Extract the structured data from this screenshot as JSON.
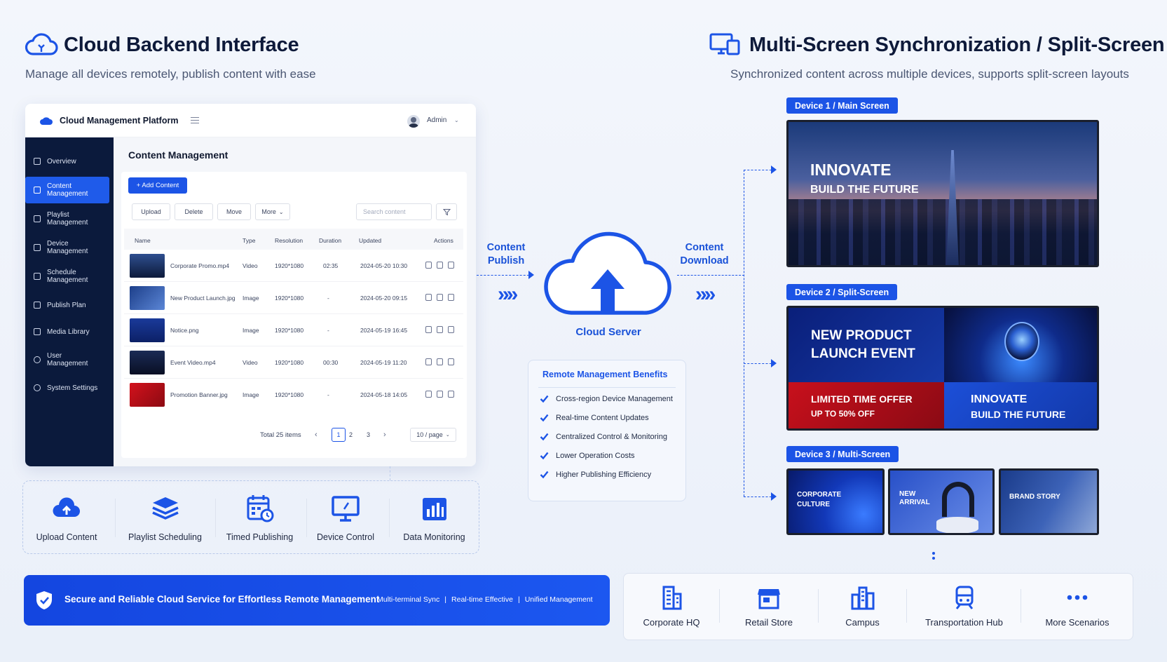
{
  "colors": {
    "accent": "#1c54e6",
    "sidebar_bg": "#0b1a3c",
    "heading": "#0e1a3a",
    "red_offer": "#c8101c"
  },
  "left_header": {
    "title": "Cloud Backend Interface",
    "subtitle": "Manage all devices remotely, publish content with ease",
    "icon": "cloud-icon"
  },
  "right_header": {
    "title": "Multi-Screen Synchronization / Split-Screen",
    "subtitle": "Synchronized content across multiple devices, supports split-screen layouts",
    "icon": "monitor-devices-icon"
  },
  "dashboard": {
    "app_title": "Cloud Management Platform",
    "user": "Admin",
    "sidebar": [
      {
        "label": "Overview",
        "icon": "home-icon"
      },
      {
        "label": "Content\nManagement",
        "icon": "edit-icon"
      },
      {
        "label": "Playlist\nManagement",
        "icon": "grid-icon"
      },
      {
        "label": "Device\nManagement",
        "icon": "grid-icon"
      },
      {
        "label": "Schedule\nManagement",
        "icon": "grid-icon"
      },
      {
        "label": "Publish Plan",
        "icon": "edit-icon"
      },
      {
        "label": "Media Library",
        "icon": "image-icon"
      },
      {
        "label": "User\nManagement",
        "icon": "user-icon"
      },
      {
        "label": "System Settings",
        "icon": "gear-icon"
      }
    ],
    "section_title": "Content Management",
    "add_button": "+ Add Content",
    "toolbar": {
      "upload": "Upload",
      "delete": "Delete",
      "move": "Move",
      "more": "More"
    },
    "search_placeholder": "Search content",
    "columns": [
      "Name",
      "Type",
      "Resolution",
      "Duration",
      "Updated",
      "Actions"
    ],
    "rows": [
      {
        "name": "Corporate Promo.mp4",
        "type": "Video",
        "resolution": "1920*1080",
        "duration": "02:35",
        "updated": "2024-05-20 10:30"
      },
      {
        "name": "New Product Launch.jpg",
        "type": "Image",
        "resolution": "1920*1080",
        "duration": "-",
        "updated": "2024-05-20 09:15"
      },
      {
        "name": "Notice.png",
        "type": "Image",
        "resolution": "1920*1080",
        "duration": "-",
        "updated": "2024-05-19 16:45"
      },
      {
        "name": "Event Video.mp4",
        "type": "Video",
        "resolution": "1920*1080",
        "duration": "00:30",
        "updated": "2024-05-19 11:20"
      },
      {
        "name": "Promotion Banner.jpg",
        "type": "Image",
        "resolution": "1920*1080",
        "duration": "-",
        "updated": "2024-05-18 14:05"
      }
    ],
    "pagination": {
      "total": "Total 25 items",
      "pages": [
        "1",
        "2",
        "3"
      ],
      "current": "1",
      "per_page": "10 / page"
    }
  },
  "features": [
    {
      "label": "Upload Content",
      "icon": "cloud-upload-icon"
    },
    {
      "label": "Playlist Scheduling",
      "icon": "layers-icon"
    },
    {
      "label": "Timed Publishing",
      "icon": "calendar-clock-icon"
    },
    {
      "label": "Device Control",
      "icon": "monitor-icon"
    },
    {
      "label": "Data Monitoring",
      "icon": "bar-chart-icon"
    }
  ],
  "banner": {
    "text": "Secure and Reliable Cloud Service for Effortless Remote Management",
    "tags": [
      "Multi-terminal Sync",
      "Real-time Effective",
      "Unified Management"
    ],
    "separator": "|",
    "icon": "shield-check-icon"
  },
  "flow": {
    "publish": "Content\nPublish",
    "download": "Content\nDownload",
    "server": "Cloud Server",
    "chevrons": "»»"
  },
  "benefits": {
    "title": "Remote Management Benefits",
    "items": [
      "Cross-region Device Management",
      "Real-time Content Updates",
      "Centralized Control & Monitoring",
      "Lower Operation Costs",
      "Higher Publishing Efficiency"
    ]
  },
  "devices": {
    "device1": {
      "tag": "Device 1 / Main Screen",
      "line1": "INNOVATE",
      "line2": "BUILD THE FUTURE"
    },
    "device2": {
      "tag": "Device 2 / Split-Screen",
      "panel1": "NEW PRODUCT\nLAUNCH EVENT",
      "panel2": "LIMITED TIME OFFER",
      "panel2_sub": "UP TO 50% OFF",
      "panel3": "INNOVATE",
      "panel3_sub": "BUILD THE FUTURE"
    },
    "device3": {
      "tag": "Device 3 / Multi-Screen",
      "screens": [
        "CORPORATE\nCULTURE",
        "NEW\nARRIVAL",
        "BRAND STORY"
      ]
    }
  },
  "scenarios": [
    {
      "label": "Corporate HQ",
      "icon": "office-building-icon"
    },
    {
      "label": "Retail Store",
      "icon": "store-icon"
    },
    {
      "label": "Campus",
      "icon": "campus-buildings-icon"
    },
    {
      "label": "Transportation Hub",
      "icon": "train-icon"
    },
    {
      "label": "More Scenarios",
      "icon": "more-dots-icon"
    }
  ]
}
